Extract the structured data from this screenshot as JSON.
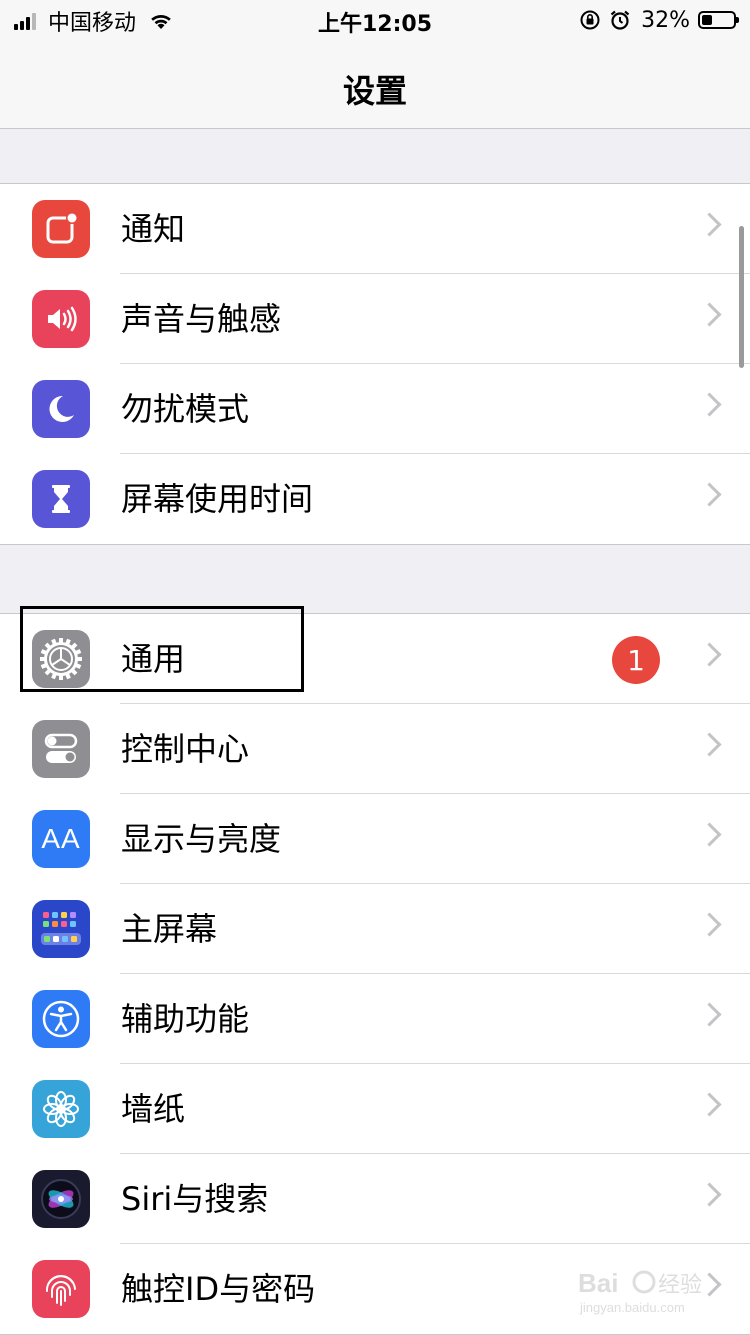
{
  "status_bar": {
    "carrier": "中国移动",
    "time": "上午12:05",
    "battery_percent": "32%",
    "battery_level": 0.32
  },
  "nav": {
    "title": "设置"
  },
  "groups": [
    {
      "items": [
        {
          "label": "通知",
          "icon": "notifications-icon",
          "color": "#e8473e"
        },
        {
          "label": "声音与触感",
          "icon": "sounds-icon",
          "color": "#e8435a"
        },
        {
          "label": "勿扰模式",
          "icon": "moon-icon",
          "color": "#5856d6"
        },
        {
          "label": "屏幕使用时间",
          "icon": "hourglass-icon",
          "color": "#5856d6"
        }
      ]
    },
    {
      "items": [
        {
          "label": "通用",
          "icon": "gear-icon",
          "color": "#8e8e93",
          "badge": "1"
        },
        {
          "label": "控制中心",
          "icon": "toggles-icon",
          "color": "#8e8e93"
        },
        {
          "label": "显示与亮度",
          "icon": "text-size-icon",
          "color": "#2f7bf6",
          "icon_text": "AA"
        },
        {
          "label": "主屏幕",
          "icon": "home-screen-icon",
          "color": "#2a46c9"
        },
        {
          "label": "辅助功能",
          "icon": "accessibility-icon",
          "color": "#2f7bf6"
        },
        {
          "label": "墙纸",
          "icon": "wallpaper-flower-icon",
          "color": "#36a4d8"
        },
        {
          "label": "Siri与搜索",
          "icon": "siri-icon",
          "color": "#1a1a2e"
        },
        {
          "label": "触控ID与密码",
          "icon": "fingerprint-icon",
          "color": "#e8435a"
        }
      ]
    }
  ],
  "watermark": {
    "text": "Baidu经验",
    "subtext": "jingyan.baidu.com"
  }
}
